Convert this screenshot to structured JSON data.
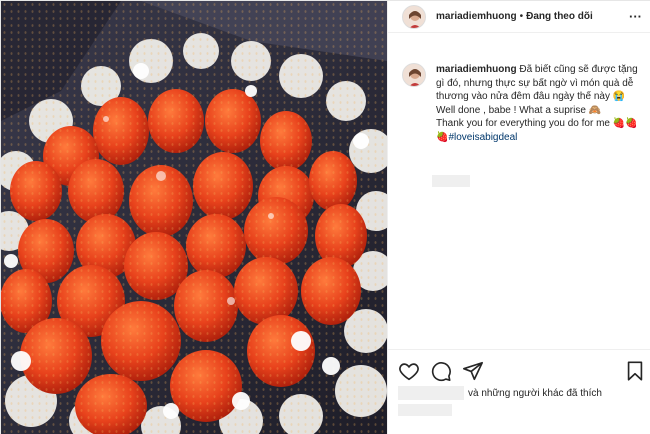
{
  "post": {
    "username": "mariadiemhuong",
    "separator": "•",
    "follow_status": "Đang theo dõi",
    "more_label": "···"
  },
  "caption": {
    "username": "mariadiemhuong",
    "line1": "Đã biết cũng sẽ được tặng gì đó, nhưng thực sự bất ngờ vì món quà dễ thương vào nửa đêm đâu ngày thế này 😭",
    "line2": "Well done , babe ! What a suprise 🙈",
    "line3": "Thank you for everything you do for me 🍓🍓🍓",
    "hashtag": "#loveisabigdeal"
  },
  "likes": {
    "text": "và những người khác đã thích"
  },
  "icons": {
    "like": "heart-icon",
    "comment": "comment-icon",
    "share": "share-icon",
    "save": "bookmark-icon",
    "more": "more-dots-icon"
  },
  "colors": {
    "strawberry": "#e8421c",
    "background": "#2c2b39",
    "link": "#00376b"
  }
}
